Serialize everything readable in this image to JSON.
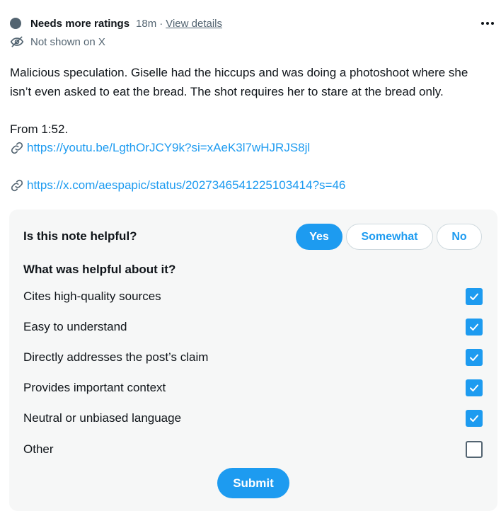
{
  "header": {
    "status_title": "Needs more ratings",
    "time": "18m",
    "separator": "·",
    "view_details": "View details",
    "visibility": "Not shown on X",
    "more_icon": "more-horizontal-icon",
    "visibility_icon": "eye-off-icon"
  },
  "note": {
    "line1": "Malicious speculation. Giselle had the hiccups and was doing a photoshoot where she isn’t even asked to eat the bread. The shot requires her to stare at the bread only.",
    "line2": "From 1:52.",
    "links": [
      {
        "text": "https://youtu.be/LgthOrJCY9k?si=xAeK3l7wHJRJS8jl",
        "icon": "link-icon"
      },
      {
        "text": "https://x.com/aespapic/status/2027346541225103414?s=46",
        "icon": "link-icon"
      }
    ]
  },
  "rating": {
    "question": "Is this note helpful?",
    "answers": [
      {
        "label": "Yes",
        "selected": true
      },
      {
        "label": "Somewhat",
        "selected": false
      },
      {
        "label": "No",
        "selected": false
      }
    ],
    "sub_question": "What was helpful about it?",
    "options": [
      {
        "label": "Cites high-quality sources",
        "checked": true
      },
      {
        "label": "Easy to understand",
        "checked": true
      },
      {
        "label": "Directly addresses the post’s claim",
        "checked": true
      },
      {
        "label": "Provides important context",
        "checked": true
      },
      {
        "label": "Neutral or unbiased language",
        "checked": true
      },
      {
        "label": "Other",
        "checked": false
      }
    ],
    "submit_label": "Submit"
  },
  "colors": {
    "accent": "#1d9bf0",
    "text": "#0f1419",
    "muted": "#536471",
    "panel_bg": "#f6f7f7"
  }
}
